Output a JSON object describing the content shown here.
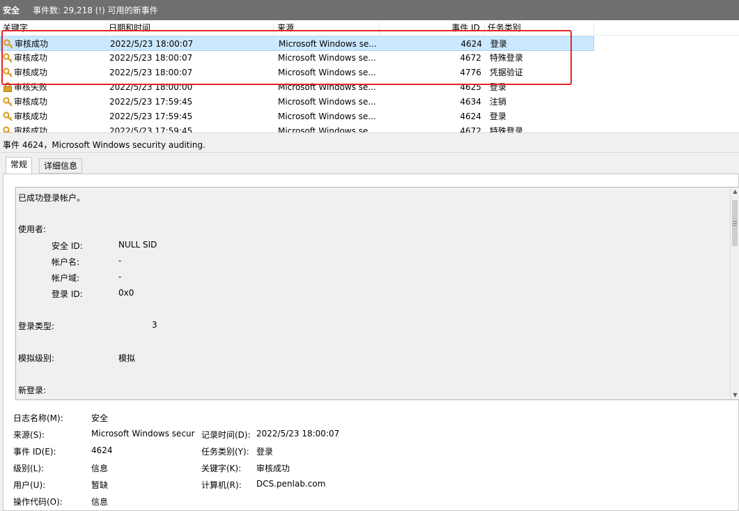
{
  "header": {
    "log_name": "安全",
    "event_count": "事件数: 29,218 (!) 可用的新事件"
  },
  "columns": [
    "关键字",
    "日期和时间",
    "来源",
    "事件 ID",
    "任务类别"
  ],
  "rows": [
    {
      "keyword": "审核成功",
      "datetime": "2022/5/23 18:00:07",
      "source": "Microsoft Windows se...",
      "event_id": "4624",
      "task": "登录",
      "icon": "key-icon"
    },
    {
      "keyword": "审核成功",
      "datetime": "2022/5/23 18:00:07",
      "source": "Microsoft Windows se...",
      "event_id": "4672",
      "task": "特殊登录",
      "icon": "key-icon"
    },
    {
      "keyword": "审核成功",
      "datetime": "2022/5/23 18:00:07",
      "source": "Microsoft Windows se...",
      "event_id": "4776",
      "task": "凭据验证",
      "icon": "key-icon"
    },
    {
      "keyword": "审核失败",
      "datetime": "2022/5/23 18:00:00",
      "source": "Microsoft Windows se...",
      "event_id": "4625",
      "task": "登录",
      "icon": "lock-icon"
    },
    {
      "keyword": "审核成功",
      "datetime": "2022/5/23 17:59:45",
      "source": "Microsoft Windows se...",
      "event_id": "4634",
      "task": "注销",
      "icon": "key-icon"
    },
    {
      "keyword": "审核成功",
      "datetime": "2022/5/23 17:59:45",
      "source": "Microsoft Windows se...",
      "event_id": "4624",
      "task": "登录",
      "icon": "key-icon"
    },
    {
      "keyword": "审核成功",
      "datetime": "2022/5/23 17:59:45",
      "source": "Microsoft Windows se...",
      "event_id": "4672",
      "task": "特殊登录",
      "icon": "key-icon"
    }
  ],
  "event_title": "事件 4624，Microsoft Windows security auditing.",
  "tabs": {
    "general": "常规",
    "details": "详细信息"
  },
  "description": {
    "intro": "已成功登录帐户。",
    "subject_label": "使用者:",
    "security_id_label": "安全 ID:",
    "security_id_value": "NULL SID",
    "account_name_label": "帐户名:",
    "account_name_value": "-",
    "account_domain_label": "帐户域:",
    "account_domain_value": "-",
    "logon_id_label": "登录 ID:",
    "logon_id_value": "0x0",
    "logon_type_label": "登录类型:",
    "logon_type_value": "3",
    "impersonation_label": "模拟级别:",
    "impersonation_value": "模拟",
    "new_logon_label": "新登录:"
  },
  "properties": {
    "log_name_label": "日志名称(M):",
    "log_name_value": "安全",
    "source_label": "来源(S):",
    "source_value": "Microsoft Windows secur",
    "logged_label": "记录时间(D):",
    "logged_value": "2022/5/23 18:00:07",
    "event_id_label": "事件 ID(E):",
    "event_id_value": "4624",
    "task_label": "任务类别(Y):",
    "task_value": "登录",
    "level_label": "级别(L):",
    "level_value": "信息",
    "keywords_label": "关键字(K):",
    "keywords_value": "审核成功",
    "user_label": "用户(U):",
    "user_value": "暂缺",
    "computer_label": "计算机(R):",
    "computer_value": "DCS.penlab.com",
    "opcode_label": "操作代码(O):",
    "opcode_value": "信息"
  },
  "colors": {
    "selection": "#cce8ff",
    "header_bg": "#6f6f6f",
    "highlight_box": "#e32222"
  }
}
